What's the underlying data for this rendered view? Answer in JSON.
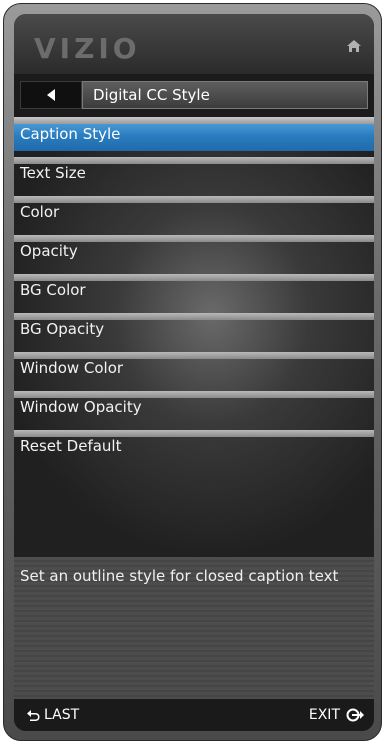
{
  "header": {
    "logo": "VIZIO",
    "home_icon": "home-icon"
  },
  "nav": {
    "back_icon": "triangle-left-icon",
    "title": "Digital CC Style"
  },
  "menu": {
    "selected_index": 0,
    "items": [
      {
        "label": "Caption Style"
      },
      {
        "label": "Text Size"
      },
      {
        "label": "Color"
      },
      {
        "label": "Opacity"
      },
      {
        "label": "BG Color"
      },
      {
        "label": "BG Opacity"
      },
      {
        "label": "Window Color"
      },
      {
        "label": "Window Opacity"
      },
      {
        "label": "Reset Default"
      }
    ]
  },
  "description": "Set an outline style for closed caption text",
  "footer": {
    "last_label": "LAST",
    "exit_label": "EXIT"
  },
  "colors": {
    "selection": "#2a7dc0"
  }
}
